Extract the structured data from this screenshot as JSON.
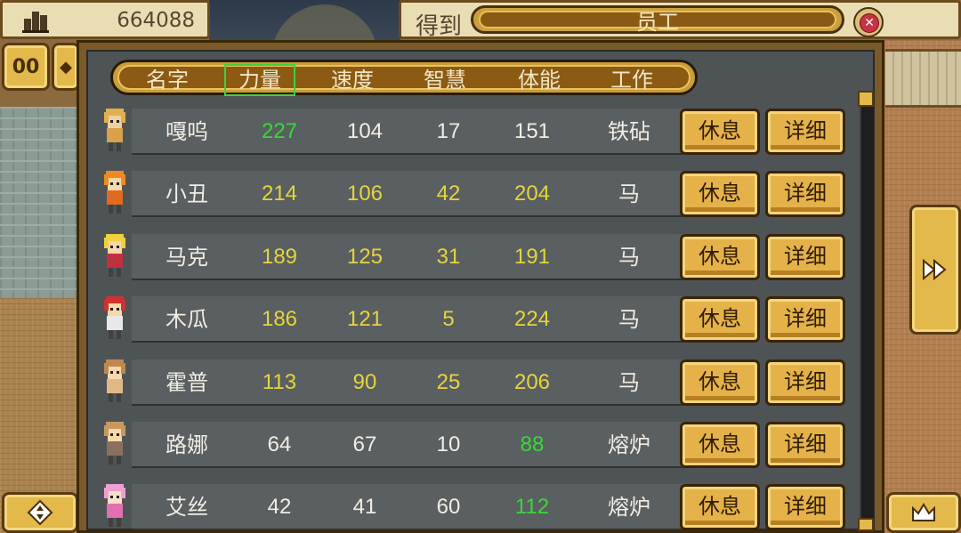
{
  "top_bar": {
    "money": "664088",
    "get_label": "得到",
    "title": "员工",
    "close_icon": "close-icon"
  },
  "side_buttons": {
    "top_left": "00",
    "next_icon": "double-arrow-icon",
    "bottom_left_icon": "dpad-icon",
    "bottom_right_icon": "crown-icon"
  },
  "columns": [
    "名字",
    "力量",
    "速度",
    "智慧",
    "体能",
    "工作"
  ],
  "selected_column": "力量",
  "colors": {
    "normal": "#f0ede4",
    "yellow": "#e6d43c",
    "green": "#38d838"
  },
  "buttons": {
    "rest": "休息",
    "detail": "详细"
  },
  "employees": [
    {
      "name": "嘎呜",
      "power": "227",
      "speed": "104",
      "wisdom": "17",
      "stamina": "151",
      "job": "铁砧",
      "power_color": "green",
      "speed_color": "normal",
      "wisdom_color": "normal",
      "stamina_color": "normal"
    },
    {
      "name": "小丑",
      "power": "214",
      "speed": "106",
      "wisdom": "42",
      "stamina": "204",
      "job": "马",
      "power_color": "yellow",
      "speed_color": "yellow",
      "wisdom_color": "yellow",
      "stamina_color": "yellow"
    },
    {
      "name": "马克",
      "power": "189",
      "speed": "125",
      "wisdom": "31",
      "stamina": "191",
      "job": "马",
      "power_color": "yellow",
      "speed_color": "yellow",
      "wisdom_color": "yellow",
      "stamina_color": "yellow"
    },
    {
      "name": "木瓜",
      "power": "186",
      "speed": "121",
      "wisdom": "5",
      "stamina": "224",
      "job": "马",
      "power_color": "yellow",
      "speed_color": "yellow",
      "wisdom_color": "yellow",
      "stamina_color": "yellow"
    },
    {
      "name": "霍普",
      "power": "113",
      "speed": "90",
      "wisdom": "25",
      "stamina": "206",
      "job": "马",
      "power_color": "yellow",
      "speed_color": "yellow",
      "wisdom_color": "yellow",
      "stamina_color": "yellow"
    },
    {
      "name": "路娜",
      "power": "64",
      "speed": "67",
      "wisdom": "10",
      "stamina": "88",
      "job": "熔炉",
      "power_color": "normal",
      "speed_color": "normal",
      "wisdom_color": "normal",
      "stamina_color": "green"
    },
    {
      "name": "艾丝",
      "power": "42",
      "speed": "41",
      "wisdom": "60",
      "stamina": "112",
      "job": "熔炉",
      "power_color": "normal",
      "speed_color": "normal",
      "wisdom_color": "normal",
      "stamina_color": "green"
    }
  ],
  "avatars": [
    {
      "hair": "#e0b050",
      "body": "#d8a24a",
      "skin": "#f0d0a0"
    },
    {
      "hair": "#f08a20",
      "body": "#e06a20",
      "skin": "#f8d8a8"
    },
    {
      "hair": "#f0d040",
      "body": "#c03040",
      "skin": "#f8d8a8"
    },
    {
      "hair": "#d03030",
      "body": "#e8e8e8",
      "skin": "#f8d8a8"
    },
    {
      "hair": "#c08850",
      "body": "#e0b888",
      "skin": "#f8d8a8"
    },
    {
      "hair": "#c89860",
      "body": "#8a7060",
      "skin": "#f8d8a8"
    },
    {
      "hair": "#f0a0d0",
      "body": "#e070b0",
      "skin": "#f8e0c8"
    }
  ]
}
